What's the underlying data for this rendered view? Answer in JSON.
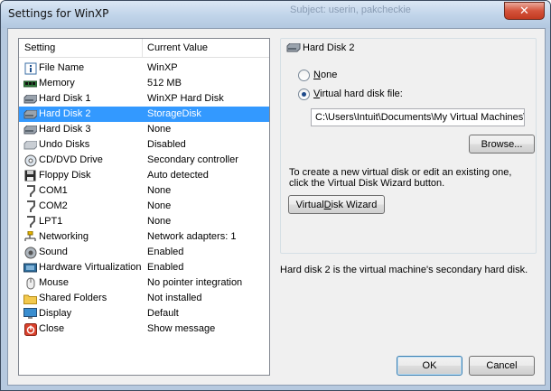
{
  "window": {
    "title": "Settings for WinXP",
    "background_text": "Subject: userin, pakcheckie"
  },
  "list": {
    "header_setting": "Setting",
    "header_value": "Current Value",
    "rows": [
      {
        "label": "File Name",
        "value": "WinXP",
        "icon": "file-name-icon"
      },
      {
        "label": "Memory",
        "value": "512 MB",
        "icon": "memory-icon"
      },
      {
        "label": "Hard Disk 1",
        "value": "WinXP Hard Disk",
        "icon": "hard-disk-icon"
      },
      {
        "label": "Hard Disk 2",
        "value": "StorageDisk",
        "icon": "hard-disk-icon"
      },
      {
        "label": "Hard Disk 3",
        "value": "None",
        "icon": "hard-disk-icon"
      },
      {
        "label": "Undo Disks",
        "value": "Disabled",
        "icon": "undo-disks-icon"
      },
      {
        "label": "CD/DVD Drive",
        "value": "Secondary controller",
        "icon": "cd-dvd-icon"
      },
      {
        "label": "Floppy Disk",
        "value": "Auto detected",
        "icon": "floppy-icon"
      },
      {
        "label": "COM1",
        "value": "None",
        "icon": "com-port-icon"
      },
      {
        "label": "COM2",
        "value": "None",
        "icon": "com-port-icon"
      },
      {
        "label": "LPT1",
        "value": "None",
        "icon": "lpt-port-icon"
      },
      {
        "label": "Networking",
        "value": "Network adapters: 1",
        "icon": "network-icon"
      },
      {
        "label": "Sound",
        "value": "Enabled",
        "icon": "sound-icon"
      },
      {
        "label": "Hardware Virtualization",
        "value": "Enabled",
        "icon": "hardware-virtualization-icon"
      },
      {
        "label": "Mouse",
        "value": "No pointer integration",
        "icon": "mouse-icon"
      },
      {
        "label": "Shared Folders",
        "value": "Not installed",
        "icon": "folder-icon"
      },
      {
        "label": "Display",
        "value": "Default",
        "icon": "display-icon"
      },
      {
        "label": "Close",
        "value": "Show message",
        "icon": "close-setting-icon"
      }
    ],
    "selected_index": 3
  },
  "panel": {
    "title": "Hard Disk 2",
    "option_none": "None",
    "option_vhd": "Virtual hard disk file:",
    "selected_option": "vhd",
    "vhd_path": "C:\\Users\\Intuit\\Documents\\My Virtual Machines\\",
    "browse_label": "Browse...",
    "wizard_description": "To create a new virtual disk or edit an existing one, click the Virtual Disk Wizard button.",
    "wizard_label": "Virtual Disk Wizard"
  },
  "info_text": "Hard disk 2 is the virtual machine's secondary hard disk.",
  "buttons": {
    "ok": "OK",
    "cancel": "Cancel"
  },
  "colors": {
    "selection": "#3399ff",
    "titlebar": "#c2d5ea",
    "close_button": "#d4533b"
  }
}
